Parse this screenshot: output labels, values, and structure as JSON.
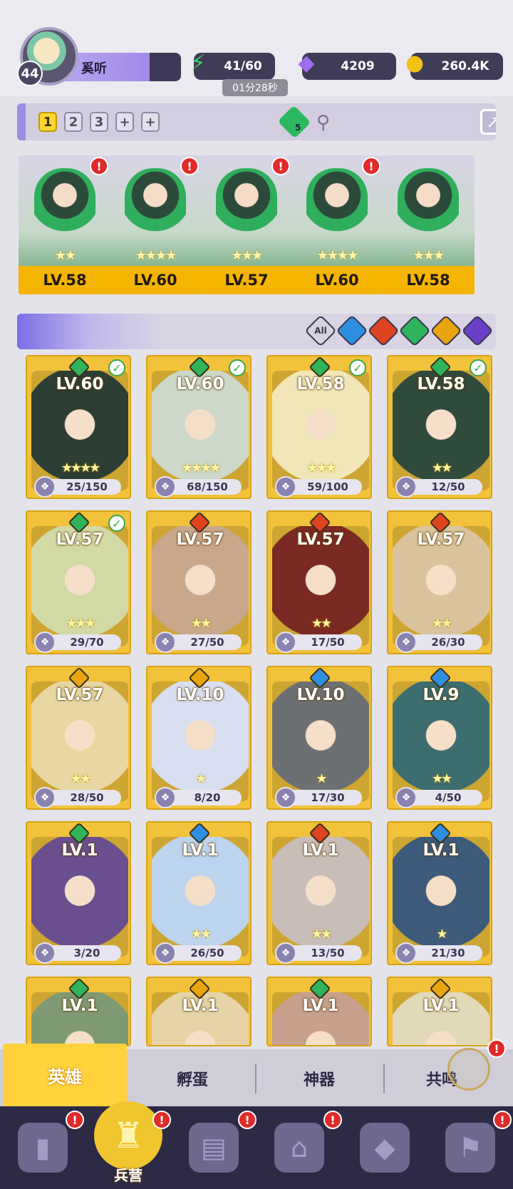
{
  "player": {
    "level": "44",
    "name": "奚听"
  },
  "resources": {
    "energy": "41/60",
    "energy_timer": "01分28秒",
    "gems": "4209",
    "gold": "260.4K"
  },
  "team": {
    "slots": [
      "1",
      "2",
      "3",
      "+",
      "+"
    ],
    "active_slot": "1",
    "gem_badge": "5",
    "members": [
      {
        "level": "LV.58",
        "stars": "★★",
        "element": "green"
      },
      {
        "level": "LV.60",
        "stars": "★★★★",
        "element": "green"
      },
      {
        "level": "LV.57",
        "stars": "★★★",
        "element": "green"
      },
      {
        "level": "LV.60",
        "stars": "★★★★",
        "element": "green"
      },
      {
        "level": "LV.58",
        "stars": "★★★",
        "element": "green"
      }
    ]
  },
  "filters": [
    "All",
    "water",
    "fire",
    "nature",
    "light",
    "dark"
  ],
  "filter_all_label": "All",
  "heroes": [
    {
      "level": "LV.60",
      "fragments": "25/150",
      "stars": "★★★★",
      "element": "green",
      "checked": true,
      "bg": "#2c3e33"
    },
    {
      "level": "LV.60",
      "fragments": "68/150",
      "stars": "★★★★",
      "element": "green",
      "checked": true,
      "bg": "#cdd8c9"
    },
    {
      "level": "LV.58",
      "fragments": "59/100",
      "stars": "★★★",
      "element": "green",
      "checked": true,
      "bg": "#f1e7b8"
    },
    {
      "level": "LV.58",
      "fragments": "12/50",
      "stars": "★★",
      "element": "green",
      "checked": true,
      "bg": "#304a3c"
    },
    {
      "level": "LV.57",
      "fragments": "29/70",
      "stars": "★★★",
      "element": "green",
      "checked": true,
      "bg": "#d3d9a4"
    },
    {
      "level": "LV.57",
      "fragments": "27/50",
      "stars": "★★",
      "element": "red",
      "checked": false,
      "bg": "#c9a78a"
    },
    {
      "level": "LV.57",
      "fragments": "17/50",
      "stars": "★★",
      "element": "red",
      "checked": false,
      "bg": "#7a2a22"
    },
    {
      "level": "LV.57",
      "fragments": "26/30",
      "stars": "★★",
      "element": "red",
      "checked": false,
      "bg": "#d9c49e"
    },
    {
      "level": "LV.57",
      "fragments": "28/50",
      "stars": "★★",
      "element": "gold",
      "checked": false,
      "bg": "#e8d7a2"
    },
    {
      "level": "LV.10",
      "fragments": "8/20",
      "stars": "★",
      "element": "gold",
      "checked": false,
      "bg": "#d8dff0"
    },
    {
      "level": "LV.10",
      "fragments": "17/30",
      "stars": "★",
      "element": "blue",
      "checked": false,
      "bg": "#6d7072"
    },
    {
      "level": "LV.9",
      "fragments": "4/50",
      "stars": "★★",
      "element": "blue",
      "checked": false,
      "bg": "#3c6d6f"
    },
    {
      "level": "LV.1",
      "fragments": "3/20",
      "stars": "",
      "element": "green",
      "checked": false,
      "bg": "#6a4f8e"
    },
    {
      "level": "LV.1",
      "fragments": "26/50",
      "stars": "★★",
      "element": "blue",
      "checked": false,
      "bg": "#bcd4ee"
    },
    {
      "level": "LV.1",
      "fragments": "13/50",
      "stars": "★★",
      "element": "red",
      "checked": false,
      "bg": "#c9bdb8"
    },
    {
      "level": "LV.1",
      "fragments": "21/30",
      "stars": "★",
      "element": "blue",
      "checked": false,
      "bg": "#3c5a7a"
    },
    {
      "level": "LV.1",
      "fragments": "",
      "stars": "",
      "element": "green",
      "checked": false,
      "bg": "#7f9a72"
    },
    {
      "level": "LV.1",
      "fragments": "",
      "stars": "",
      "element": "gold",
      "checked": false,
      "bg": "#e6d3a8"
    },
    {
      "level": "LV.1",
      "fragments": "",
      "stars": "",
      "element": "green",
      "checked": false,
      "bg": "#c7a08e"
    },
    {
      "level": "LV.1",
      "fragments": "",
      "stars": "",
      "element": "gold",
      "checked": false,
      "bg": "#e2d9b8"
    }
  ],
  "tabs": [
    "英雄",
    "孵蛋",
    "神器",
    "共鸣"
  ],
  "active_tab": "英雄",
  "nav": [
    {
      "icon": "cards-icon",
      "label": ""
    },
    {
      "icon": "barracks-icon",
      "label": "兵营"
    },
    {
      "icon": "book-icon",
      "label": ""
    },
    {
      "icon": "temple-icon",
      "label": ""
    },
    {
      "icon": "mushroom-icon",
      "label": ""
    },
    {
      "icon": "guild-banner-icon",
      "label": ""
    }
  ],
  "colors": {
    "green": "#2fb35b",
    "red": "#e0431f",
    "blue": "#2e8ee0",
    "gold": "#e9a510",
    "dark": "#6a3fc8",
    "accent": "#ffd23c"
  }
}
